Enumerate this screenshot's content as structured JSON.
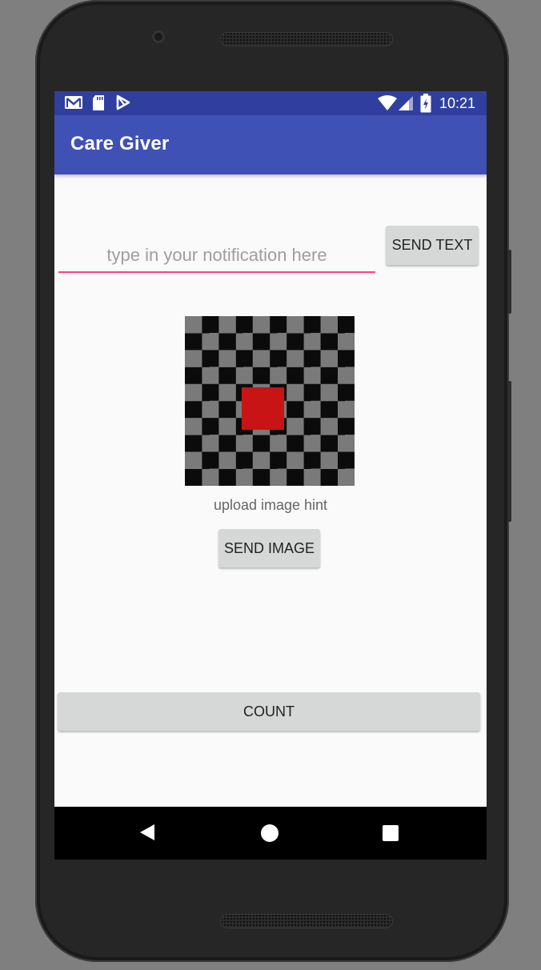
{
  "status_bar": {
    "time": "10:21",
    "icons": [
      "gmail-icon",
      "sd-card-icon",
      "play-store-icon",
      "wifi-icon",
      "signal-icon",
      "battery-charging-icon"
    ]
  },
  "app_bar": {
    "title": "Care Giver"
  },
  "notification": {
    "input_value": "",
    "placeholder": "type in your notification here",
    "send_text_label": "SEND TEXT"
  },
  "image_section": {
    "hint": "upload image hint",
    "send_image_label": "SEND IMAGE"
  },
  "count_label": "COUNT",
  "nav_bar": {
    "icons": [
      "back-icon",
      "home-icon",
      "recents-icon"
    ]
  },
  "colors": {
    "status_bar": "#303f9f",
    "app_bar": "#3f51b5",
    "accent": "#ff4081",
    "button": "#d6d7d7",
    "placeholder_red": "#c81414"
  }
}
